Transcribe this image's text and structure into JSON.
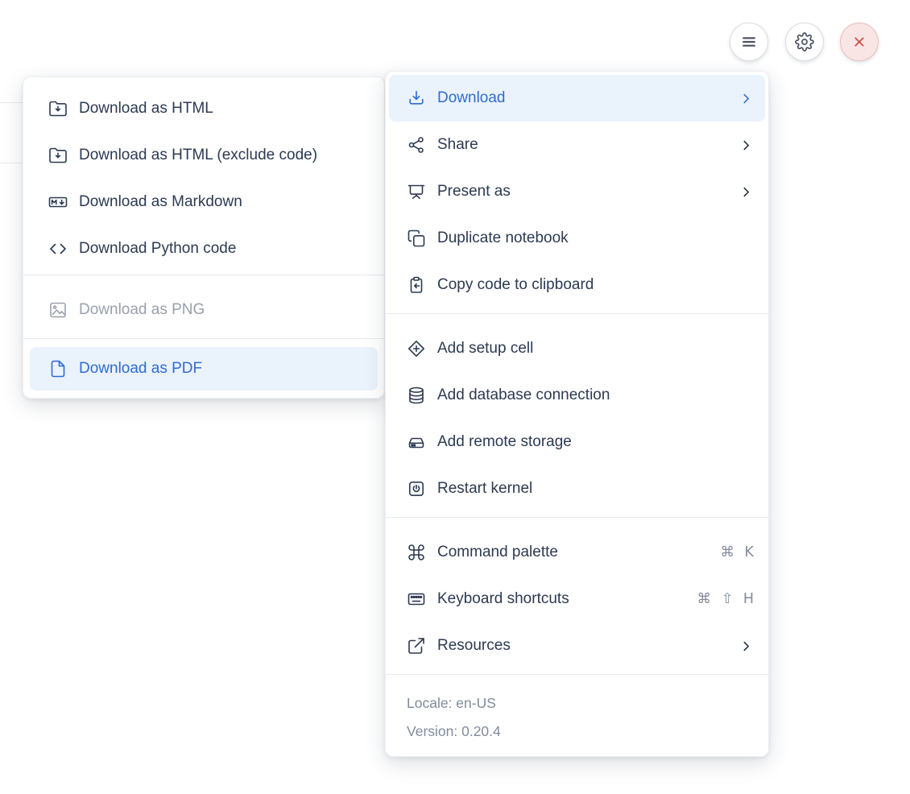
{
  "colors": {
    "accent_blue": "#2f6cd0",
    "highlight_bg": "#eaf2fc",
    "text_navy": "#2c3a52",
    "disabled_gray": "#99a0ab",
    "muted_gray": "#7f8b9b",
    "danger_red": "#d0453f",
    "danger_bg": "#f8e5e4",
    "separator": "#e6e9ed"
  },
  "topbar": {
    "buttons": [
      {
        "name": "menu",
        "icon": "hamburger-icon"
      },
      {
        "name": "settings",
        "icon": "gear-icon"
      },
      {
        "name": "close",
        "icon": "close-icon"
      }
    ]
  },
  "submenu": {
    "items": [
      {
        "label": "Download as HTML",
        "icon": "folder-download-icon"
      },
      {
        "label": "Download as HTML (exclude code)",
        "icon": "folder-download-icon"
      },
      {
        "label": "Download as Markdown",
        "icon": "markdown-icon"
      },
      {
        "label": "Download Python code",
        "icon": "code-icon"
      },
      {
        "label": "Download as PNG",
        "icon": "image-icon",
        "disabled": true
      },
      {
        "label": "Download as PDF",
        "icon": "file-icon",
        "highlighted": true
      }
    ]
  },
  "menu": {
    "items": [
      {
        "label": "Download",
        "icon": "download-icon",
        "chevron": true,
        "active": true
      },
      {
        "label": "Share",
        "icon": "share-icon",
        "chevron": true
      },
      {
        "label": "Present as",
        "icon": "present-icon",
        "chevron": true
      },
      {
        "label": "Duplicate notebook",
        "icon": "duplicate-icon"
      },
      {
        "label": "Copy code to clipboard",
        "icon": "clipboard-copy-icon"
      },
      {
        "label": "Add setup cell",
        "icon": "add-setup-cell-icon"
      },
      {
        "label": "Add database connection",
        "icon": "database-icon"
      },
      {
        "label": "Add remote storage",
        "icon": "remote-storage-icon"
      },
      {
        "label": "Restart kernel",
        "icon": "restart-kernel-icon"
      },
      {
        "label": "Command palette",
        "icon": "command-icon",
        "shortcut": "⌘ K"
      },
      {
        "label": "Keyboard shortcuts",
        "icon": "keyboard-icon",
        "shortcut": "⌘ ⇧ H"
      },
      {
        "label": "Resources",
        "icon": "external-link-icon",
        "chevron": true
      }
    ],
    "footer": {
      "locale": "Locale: en-US",
      "version": "Version: 0.20.4"
    }
  }
}
